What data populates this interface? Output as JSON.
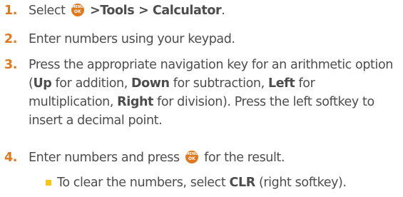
{
  "steps": [
    {
      "number": "1.",
      "pre": "Select",
      "icon": "menu-ok-icon",
      "bold": ">Tools > Calculator",
      "post": "."
    },
    {
      "number": "2.",
      "text": "Enter numbers using your keypad."
    },
    {
      "number": "3.",
      "t1": "Press the appropriate navigation key for an arithmetic option (",
      "b_up": "Up",
      "t2": " for addition, ",
      "b_down": "Down",
      "t3": " for subtraction, ",
      "b_left": "Left",
      "t4": " for multiplication, ",
      "b_right": "Right",
      "t5": " for division). Press the left softkey to insert a decimal point."
    },
    {
      "number": "4.",
      "pre": "Enter numbers and press",
      "icon": "menu-ok-icon",
      "post": "for the result."
    }
  ],
  "bullet": {
    "pre": "To clear the numbers, select ",
    "bold": "CLR",
    "post": " (right softkey)."
  },
  "icon_text": {
    "line1": "MENU",
    "line2": "OK"
  },
  "colors": {
    "accent": "#e0781e",
    "bullet": "#f5c518",
    "text": "#4d4d4d"
  }
}
